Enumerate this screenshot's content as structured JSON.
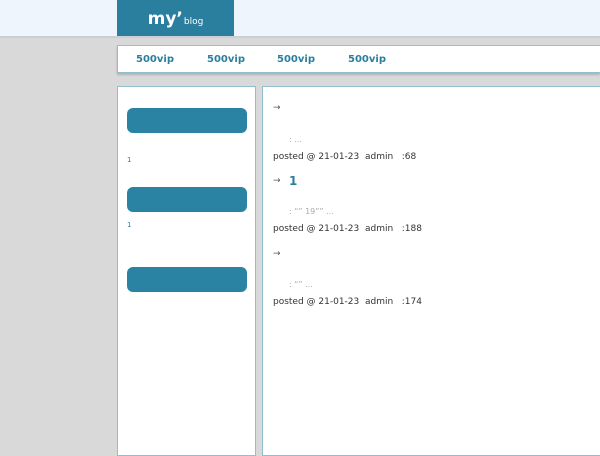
{
  "header": {
    "logo_main": "my’",
    "logo_sub": "blog"
  },
  "nav": {
    "items": [
      {
        "label": "500vip"
      },
      {
        "label": "500vip"
      },
      {
        "label": "500vip"
      },
      {
        "label": "500vip"
      }
    ]
  },
  "sidebar": {
    "widgets": [
      {
        "count": "1"
      },
      {
        "count": "1"
      },
      {
        "count": ""
      }
    ]
  },
  "posts": [
    {
      "arrow": "→",
      "title": "",
      "summary": ":    ...",
      "meta_prefix": "posted @ 21-01-23  admin   :68"
    },
    {
      "arrow": "→",
      "title": "1",
      "summary": ":    “” 19”” ...",
      "meta_prefix": "posted @ 21-01-23  admin   :188"
    },
    {
      "arrow": "→",
      "title": "",
      "summary": ":    “” ...",
      "meta_prefix": "posted @ 21-01-23  admin   :174"
    }
  ],
  "colors": {
    "accent": "#2b7f9e",
    "page_bg": "#d9d9d9",
    "topbar_bg": "#eef5fd"
  }
}
